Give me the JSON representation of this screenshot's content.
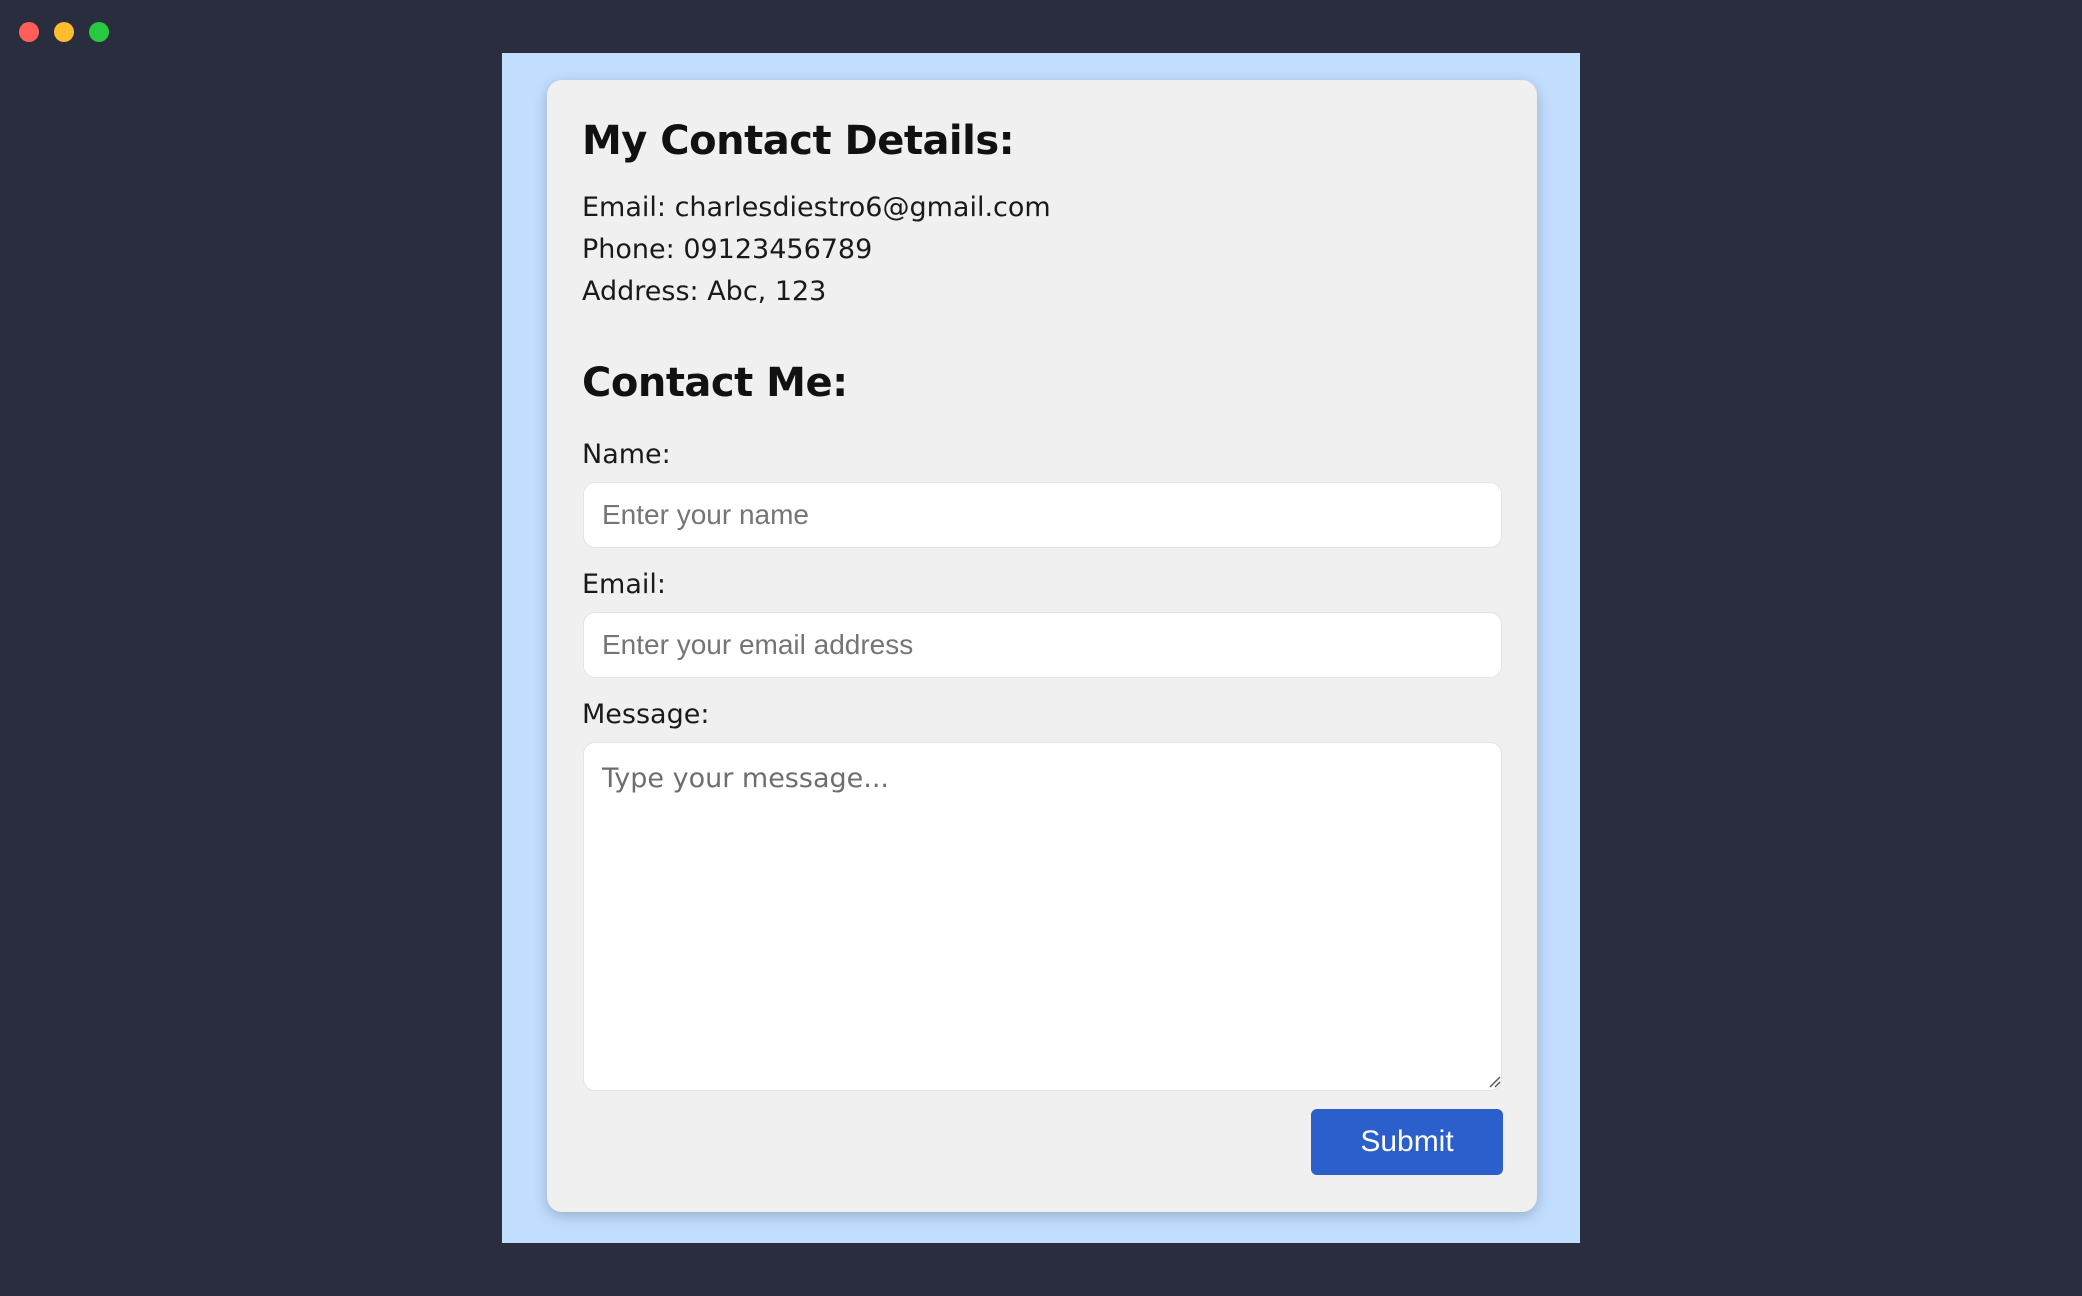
{
  "window": {
    "controls": [
      "close",
      "minimize",
      "maximize"
    ]
  },
  "details": {
    "heading": "My Contact Details:",
    "email_line": "Email: charlesdiestro6@gmail.com",
    "phone_line": "Phone: 09123456789",
    "address_line": "Address: Abc, 123"
  },
  "form": {
    "heading": "Contact Me:",
    "name_label": "Name:",
    "name_placeholder": "Enter your name",
    "name_value": "",
    "email_label": "Email:",
    "email_placeholder": "Enter your email address",
    "email_value": "",
    "message_label": "Message:",
    "message_placeholder": "Type your message...",
    "message_value": "",
    "submit_label": "Submit"
  },
  "colors": {
    "desktop_background": "#292d3e",
    "page_background": "#c2deff",
    "card_background": "#f0f0f0",
    "button": "#2b5fcc",
    "close": "#ff5f57",
    "minimize": "#febc2e",
    "maximize": "#28c840"
  }
}
